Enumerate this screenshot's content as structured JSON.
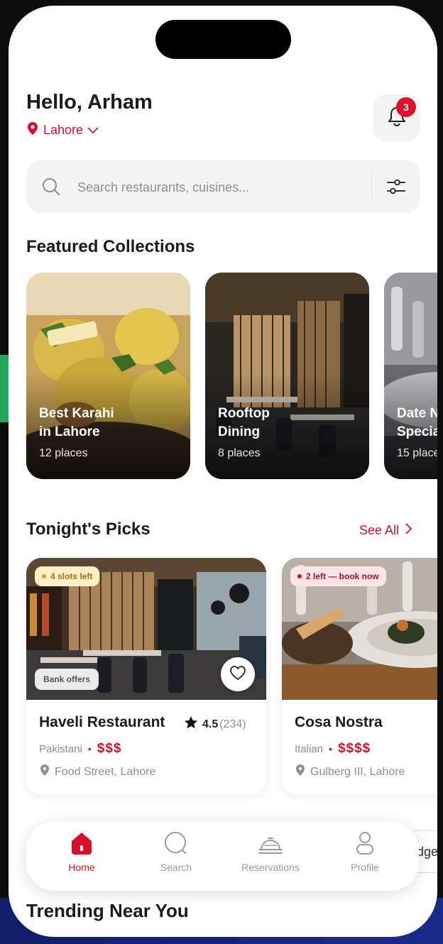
{
  "header": {
    "greeting": "Hello, Arham",
    "location": "Lahore",
    "notification_count": "3"
  },
  "search": {
    "placeholder": "Search restaurants, cuisines..."
  },
  "featured": {
    "title": "Featured Collections",
    "collections": [
      {
        "title": "Best Karahi\nin Lahore",
        "count": "12 places"
      },
      {
        "title": "Rooftop\nDining",
        "count": "8 places"
      },
      {
        "title": "Date N\nSpecia",
        "count": "15 place"
      }
    ]
  },
  "picks": {
    "title": "Tonight's Picks",
    "see_all": "See All",
    "items": [
      {
        "availability": "4 slots left",
        "offer": "Bank offers",
        "name": "Haveli Restaurant",
        "rating": "4.5",
        "reviews": "(234)",
        "cuisine": "Pakistani",
        "price": "$$$",
        "address": "Food Street, Lahore"
      },
      {
        "availability": "2 left — book now",
        "name": "Cosa Nostra",
        "cuisine": "Italian",
        "price": "$$$$",
        "address": "Gulberg III, Lahore"
      }
    ]
  },
  "nav": {
    "items": [
      {
        "label": "Home",
        "icon": "home-icon",
        "active": true
      },
      {
        "label": "Search",
        "icon": "search-icon",
        "active": false
      },
      {
        "label": "Reservations",
        "icon": "cloche-icon",
        "active": false
      },
      {
        "label": "Profile",
        "icon": "profile-icon",
        "active": false
      }
    ],
    "peek_text": "dge"
  },
  "trending": {
    "title": "Trending Near You"
  },
  "colors": {
    "accent": "#d6102a",
    "amber_pill": "#fdf0c8",
    "red_pill": "#fde4e6"
  }
}
